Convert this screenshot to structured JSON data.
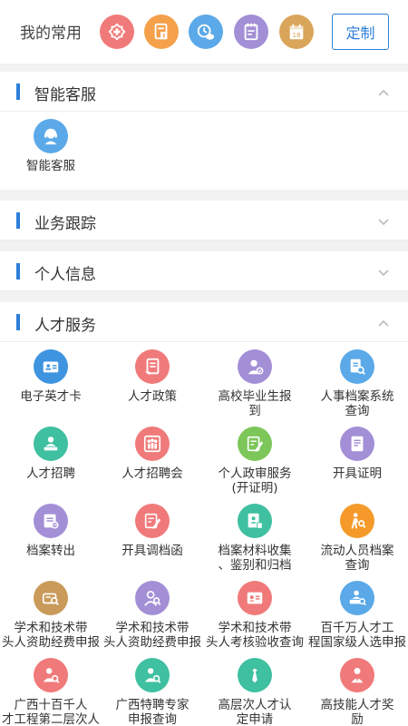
{
  "favorites": {
    "title": "我的常用",
    "custom_label": "定制",
    "icons": [
      {
        "name": "favorite-medical-icon",
        "color": "#f07a7a"
      },
      {
        "name": "favorite-document-icon",
        "color": "#f5a04a"
      },
      {
        "name": "favorite-chat-clock-icon",
        "color": "#5ba9e8"
      },
      {
        "name": "favorite-notepad-icon",
        "color": "#a38fd6"
      },
      {
        "name": "favorite-calendar-icon",
        "color": "#d9a55a",
        "text": "18"
      }
    ]
  },
  "sections": {
    "smart_service": {
      "title": "智能客服",
      "items": [
        {
          "label": "智能客服",
          "icon": "customer-service-icon",
          "color": "#5ba9e8"
        }
      ]
    },
    "business_tracking": {
      "title": "业务跟踪"
    },
    "personal_info": {
      "title": "个人信息"
    },
    "talent_service": {
      "title": "人才服务",
      "items": [
        {
          "label": "电子英才卡",
          "icon": "id-card-icon",
          "color": "#3f94e0"
        },
        {
          "label": "人才政策",
          "icon": "policy-doc-icon",
          "color": "#f07a7a"
        },
        {
          "label": "高校毕业生报\n到",
          "icon": "graduate-icon",
          "color": "#a38fd6"
        },
        {
          "label": "人事档案系统\n查询",
          "icon": "archive-search-icon",
          "color": "#5ba9e8"
        },
        {
          "label": "人才招聘",
          "icon": "recruit-icon",
          "color": "#3fc0a0"
        },
        {
          "label": "人才招聘会",
          "icon": "job-fair-icon",
          "color": "#f07a7a"
        },
        {
          "label": "个人政审服务\n(开证明)",
          "icon": "review-pen-icon",
          "color": "#7cc65a"
        },
        {
          "label": "开具证明",
          "icon": "certificate-icon",
          "color": "#a38fd6"
        },
        {
          "label": "档案转出",
          "icon": "archive-out-icon",
          "color": "#a38fd6"
        },
        {
          "label": "开具调档函",
          "icon": "transfer-letter-icon",
          "color": "#f07a7a"
        },
        {
          "label": "档案材料收集\n、鉴别和归档",
          "icon": "archive-collect-icon",
          "color": "#3fc0a0"
        },
        {
          "label": "流动人员档案\n查询",
          "icon": "mobile-person-search-icon",
          "color": "#f59a2a"
        },
        {
          "label": "学术和技术带\n头人资助经费申报",
          "icon": "funding-search-icon",
          "color": "#c99a5a"
        },
        {
          "label": "学术和技术带\n头人资助经费申报",
          "icon": "leader-search-icon",
          "color": "#a38fd6"
        },
        {
          "label": "学术和技术带\n头人考核验收查询",
          "icon": "assessment-card-icon",
          "color": "#f07a7a"
        },
        {
          "label": "百千万人才工\n程国家级人选申报",
          "icon": "national-talent-icon",
          "color": "#5ba9e8"
        },
        {
          "label": "广西十百千人\n才工程第二层次人",
          "icon": "guangxi-talent-icon",
          "color": "#f07a7a"
        },
        {
          "label": "广西特聘专家\n申报查询",
          "icon": "expert-search-icon",
          "color": "#3fc0a0"
        },
        {
          "label": "高层次人才认\n定申请",
          "icon": "high-talent-tie-icon",
          "color": "#3fc0a0"
        },
        {
          "label": "高技能人才奖\n励",
          "icon": "skill-award-icon",
          "color": "#f07a7a"
        }
      ]
    }
  }
}
